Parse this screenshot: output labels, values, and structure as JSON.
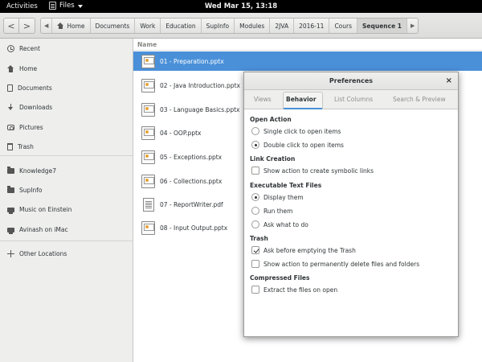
{
  "topbar": {
    "activities": "Activities",
    "app_menu": "Files",
    "clock": "Wed Mar 15, 13:18"
  },
  "header": {
    "back": "<",
    "forward": ">",
    "scroll_left": "◀",
    "scroll_right": "▶",
    "breadcrumbs": [
      "Home",
      "Documents",
      "Work",
      "Education",
      "SupInfo",
      "Modules",
      "2JVA",
      "2016-11",
      "Cours",
      "Sequence 1"
    ],
    "active_crumb": "Sequence 1"
  },
  "sidebar": {
    "items": [
      {
        "label": "Recent",
        "icon": "recent-icon"
      },
      {
        "label": "Home",
        "icon": "home-icon"
      },
      {
        "label": "Documents",
        "icon": "document-icon"
      },
      {
        "label": "Downloads",
        "icon": "download-icon"
      },
      {
        "label": "Pictures",
        "icon": "camera-icon"
      },
      {
        "label": "Trash",
        "icon": "trash-icon"
      },
      {
        "label": "Knowledge7",
        "icon": "folder-icon"
      },
      {
        "label": "SupInfo",
        "icon": "folder-icon"
      },
      {
        "label": "Music on Einstein",
        "icon": "network-drive-icon"
      },
      {
        "label": "Avinash on iMac",
        "icon": "network-drive-icon"
      },
      {
        "label": "Other Locations",
        "icon": "plus-icon"
      }
    ]
  },
  "filelist": {
    "column_name": "Name",
    "files": [
      {
        "name": "01 - Preparation.pptx",
        "type": "pptx",
        "selected": true
      },
      {
        "name": "02 - Java Introduction.pptx",
        "type": "pptx"
      },
      {
        "name": "03 - Language Basics.pptx",
        "type": "pptx"
      },
      {
        "name": "04 - OOP.pptx",
        "type": "pptx"
      },
      {
        "name": "05 - Exceptions.pptx",
        "type": "pptx"
      },
      {
        "name": "06 - Collections.pptx",
        "type": "pptx"
      },
      {
        "name": "07 - ReportWriter.pdf",
        "type": "pdf"
      },
      {
        "name": "08 - Input Output.pptx",
        "type": "pptx"
      }
    ]
  },
  "dialog": {
    "title": "Preferences",
    "close": "×",
    "tabs": [
      "Views",
      "Behavior",
      "List Columns",
      "Search & Preview"
    ],
    "active_tab": "Behavior",
    "sections": {
      "open_action": {
        "title": "Open Action",
        "options": [
          "Single click to open items",
          "Double click to open items"
        ],
        "selected": "Double click to open items"
      },
      "link_creation": {
        "title": "Link Creation",
        "option": "Show action to create symbolic links",
        "checked": false
      },
      "executable": {
        "title": "Executable Text Files",
        "options": [
          "Display them",
          "Run them",
          "Ask what to do"
        ],
        "selected": "Display them"
      },
      "trash": {
        "title": "Trash",
        "options": [
          {
            "label": "Ask before emptying the Trash",
            "checked": true
          },
          {
            "label": "Show action to permanently delete files and folders",
            "checked": false
          }
        ]
      },
      "compressed": {
        "title": "Compressed Files",
        "option": "Extract the files on open",
        "checked": false
      }
    }
  },
  "colors": {
    "selection": "#4a90d9",
    "topbar_bg": "#000000",
    "sidebar_bg": "#eeeeed"
  }
}
